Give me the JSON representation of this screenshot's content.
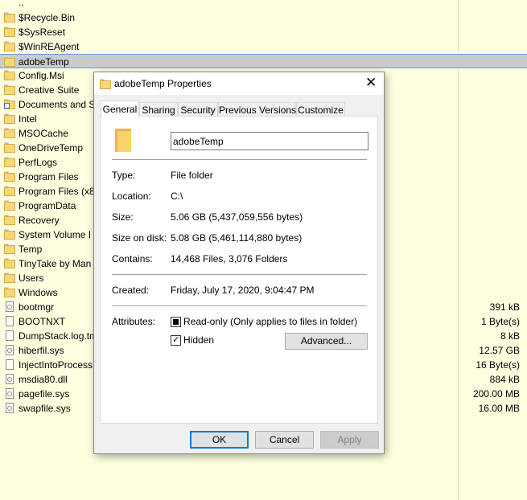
{
  "explorer": {
    "parent_label": "..",
    "rows": [
      {
        "name": "$Recycle.Bin",
        "icon": "folder-icon"
      },
      {
        "name": "$SysReset",
        "icon": "folder-icon"
      },
      {
        "name": "$WinREAgent",
        "icon": "folder-icon"
      },
      {
        "name": "adobeTemp",
        "icon": "folder-icon",
        "selected": true
      },
      {
        "name": "Config.Msi",
        "icon": "folder-icon"
      },
      {
        "name": "Creative Suite",
        "icon": "folder-icon"
      },
      {
        "name": "Documents and S",
        "icon": "shortcut-icon"
      },
      {
        "name": "Intel",
        "icon": "folder-icon"
      },
      {
        "name": "MSOCache",
        "icon": "folder-icon"
      },
      {
        "name": "OneDriveTemp",
        "icon": "folder-icon"
      },
      {
        "name": "PerfLogs",
        "icon": "folder-icon"
      },
      {
        "name": "Program Files",
        "icon": "folder-icon"
      },
      {
        "name": "Program Files (x8",
        "icon": "folder-icon"
      },
      {
        "name": "ProgramData",
        "icon": "folder-icon"
      },
      {
        "name": "Recovery",
        "icon": "folder-icon"
      },
      {
        "name": "System Volume I",
        "icon": "folder-icon"
      },
      {
        "name": "Temp",
        "icon": "folder-icon"
      },
      {
        "name": "TinyTake by Man",
        "icon": "folder-icon"
      },
      {
        "name": "Users",
        "icon": "folder-icon"
      },
      {
        "name": "Windows",
        "icon": "folder-icon"
      },
      {
        "name": "bootmgr",
        "icon": "system-file-icon",
        "size": "391 kB"
      },
      {
        "name": "BOOTNXT",
        "icon": "file-icon",
        "size": "1 Byte(s)"
      },
      {
        "name": "DumpStack.log.tm",
        "icon": "file-icon",
        "size": "8 kB"
      },
      {
        "name": "hiberfil.sys",
        "icon": "system-file-icon",
        "size": "12.57 GB"
      },
      {
        "name": "InjectIntoProcess",
        "icon": "file-icon",
        "size": "16 Byte(s)"
      },
      {
        "name": "msdia80.dll",
        "icon": "dll-file-icon",
        "size": "884 kB"
      },
      {
        "name": "pagefile.sys",
        "icon": "system-file-icon",
        "size": "200.00 MB"
      },
      {
        "name": "swapfile.sys",
        "icon": "system-file-icon",
        "size": "16.00 MB"
      }
    ]
  },
  "dialog": {
    "title": "adobeTemp Properties",
    "close_glyph": "✕",
    "tabs": [
      "General",
      "Sharing",
      "Security",
      "Previous Versions",
      "Customize"
    ],
    "name_value": "adobeTemp",
    "props": {
      "type_label": "Type:",
      "type_value": "File folder",
      "location_label": "Location:",
      "location_value": "C:\\",
      "size_label": "Size:",
      "size_value": "5.06 GB (5,437,059,556 bytes)",
      "size_on_disk_label": "Size on disk:",
      "size_on_disk_value": "5.08 GB (5,461,114,880 bytes)",
      "contains_label": "Contains:",
      "contains_value": "14,468 Files, 3,076 Folders",
      "created_label": "Created:",
      "created_value": "Friday, July 17, 2020, 9:04:47 PM",
      "attributes_label": "Attributes:",
      "readonly_label": "Read-only (Only applies to files in folder)",
      "hidden_label": "Hidden",
      "advanced_label": "Advanced..."
    },
    "buttons": {
      "ok": "OK",
      "cancel": "Cancel",
      "apply": "Apply"
    }
  },
  "colors": {
    "list_bg": "#ffffe0",
    "selection_border": "#6b9bd7",
    "default_button_border": "#0078d7"
  }
}
